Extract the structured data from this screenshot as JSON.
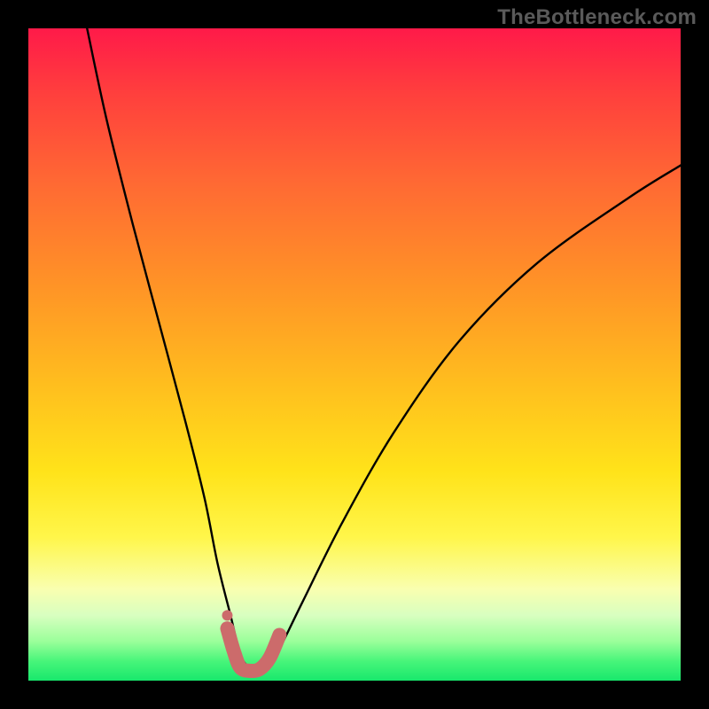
{
  "watermark": "TheBottleneck.com",
  "chart_data": {
    "type": "line",
    "title": "",
    "xlabel": "",
    "ylabel": "",
    "xlim": [
      0,
      100
    ],
    "ylim": [
      0,
      100
    ],
    "grid": false,
    "legend": false,
    "series": [
      {
        "name": "bottleneck-curve",
        "color": "#000000",
        "x": [
          9,
          12,
          16,
          20,
          24,
          27,
          29,
          31,
          32.5,
          34,
          36,
          38,
          42,
          48,
          56,
          66,
          78,
          92,
          100
        ],
        "y": [
          100,
          86,
          70,
          55,
          40,
          28,
          18,
          10,
          4,
          2,
          2,
          4,
          12,
          24,
          38,
          52,
          64,
          74,
          79
        ]
      },
      {
        "name": "valley-highlight",
        "color": "#cc6b6b",
        "x": [
          30.5,
          31.5,
          32.5,
          34,
          35.5,
          37,
          38.5
        ],
        "y": [
          8,
          4.5,
          2,
          1.5,
          1.8,
          3.5,
          7
        ]
      }
    ],
    "markers": [
      {
        "name": "highlight-dot",
        "x": 30.5,
        "y": 10,
        "color": "#cc6b6b",
        "r": 6
      }
    ],
    "gradient_stops": [
      {
        "pos": 0,
        "color": "#ff1a49"
      },
      {
        "pos": 55,
        "color": "#ffbf1e"
      },
      {
        "pos": 78,
        "color": "#fff64a"
      },
      {
        "pos": 100,
        "color": "#18e86c"
      }
    ]
  }
}
